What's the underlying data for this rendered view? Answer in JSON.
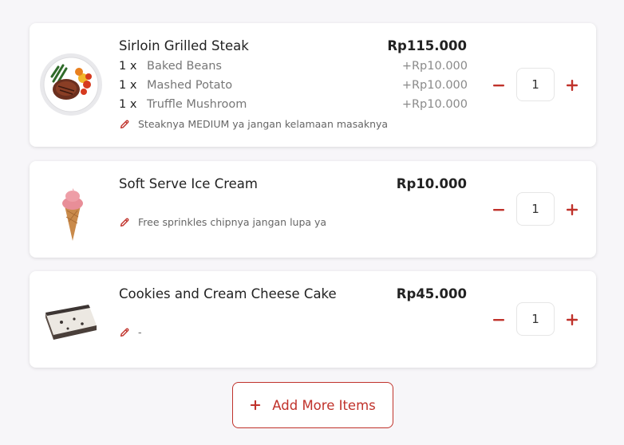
{
  "colors": {
    "accent": "#c0322b",
    "card_bg": "#ffffff",
    "page_bg": "#f7f6f9"
  },
  "items": [
    {
      "name": "Sirloin Grilled Steak",
      "price": "Rp115.000",
      "image_icon": "steak-plate-image",
      "addons": [
        {
          "qty": "1 x",
          "name": "Baked Beans",
          "price": "+Rp10.000"
        },
        {
          "qty": "1 x",
          "name": "Mashed Potato",
          "price": "+Rp10.000"
        },
        {
          "qty": "1 x",
          "name": "Truffle Mushroom",
          "price": "+Rp10.000"
        }
      ],
      "note": "Steaknya MEDIUM ya jangan kelamaan masaknya",
      "quantity": "1"
    },
    {
      "name": "Soft Serve Ice Cream",
      "price": "Rp10.000",
      "image_icon": "ice-cream-cone-image",
      "note": "Free sprinkles chipnya jangan lupa ya",
      "quantity": "1"
    },
    {
      "name": "Cookies and Cream Cheese Cake",
      "price": "Rp45.000",
      "image_icon": "cheesecake-slice-image",
      "note": "-",
      "quantity": "1"
    }
  ],
  "stepper": {
    "minus_icon": "minus-icon",
    "plus_icon": "plus-icon"
  },
  "add_more": {
    "label": "Add More Items",
    "icon": "plus-icon"
  }
}
